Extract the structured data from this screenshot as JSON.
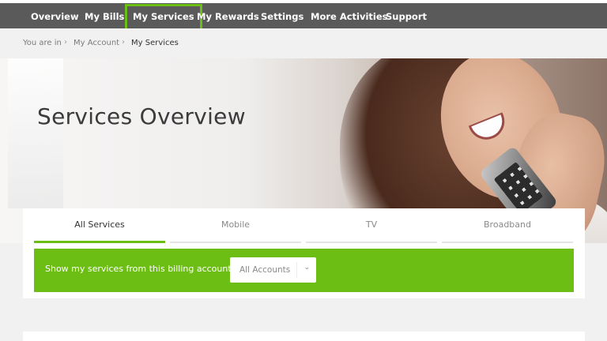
{
  "nav": {
    "items": [
      {
        "label": "Overview"
      },
      {
        "label": "My Bills"
      },
      {
        "label": "My Services"
      },
      {
        "label": "My Rewards"
      },
      {
        "label": "Settings"
      },
      {
        "label": "More Activities"
      },
      {
        "label": "Support"
      }
    ],
    "active": "My Services"
  },
  "breadcrumb": {
    "prefix": "You are in",
    "items": [
      "My Account",
      "My Services"
    ],
    "separator": "›"
  },
  "hero": {
    "title": "Services Overview"
  },
  "tabs": [
    {
      "label": "All Services",
      "active": true
    },
    {
      "label": "Mobile",
      "active": false
    },
    {
      "label": "TV",
      "active": false
    },
    {
      "label": "Broadband",
      "active": false
    }
  ],
  "filter": {
    "label": "Show my services from this billing account :",
    "select_value": "All Accounts",
    "chevron": "⌄"
  },
  "colors": {
    "accent": "#6cbe14",
    "nav_bg": "#5a5a5a",
    "page_bg": "#f1f1f1"
  }
}
